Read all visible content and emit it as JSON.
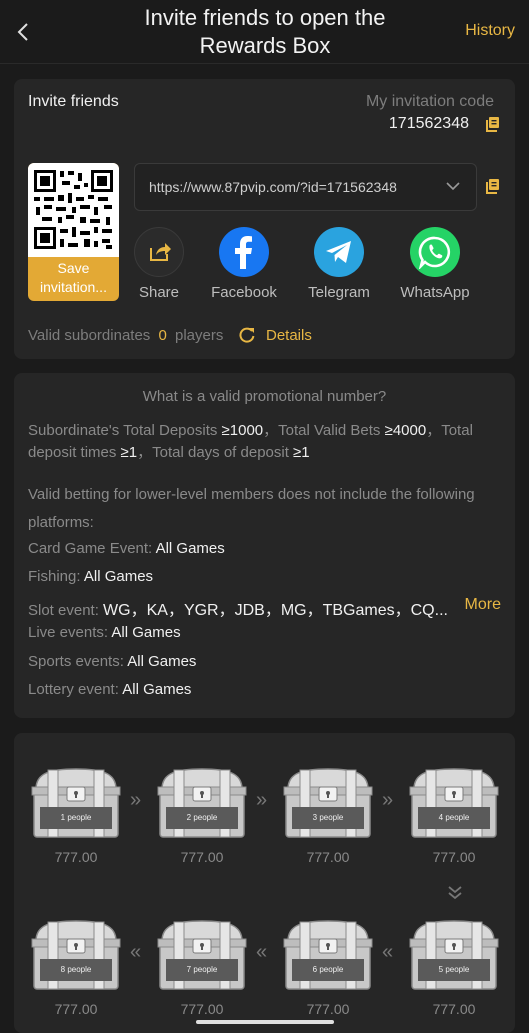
{
  "header": {
    "title": "Invite friends to open the Rewards Box",
    "title_line1": "Invite friends to open the",
    "title_line2": "Rewards Box",
    "history_label": "History",
    "back_icon": "chevron-left-icon"
  },
  "invite": {
    "title": "Invite friends",
    "my_code_label": "My invitation code",
    "my_code": "171562348",
    "url": "https://www.87pvip.com/?id=171562348",
    "save_label_line1": "Save",
    "save_label_line2": "invitation...",
    "share_options": [
      {
        "label": "Share",
        "icon": "share-icon",
        "color": "#2b2b2b"
      },
      {
        "label": "Facebook",
        "icon": "facebook-icon",
        "color": "#1877f2"
      },
      {
        "label": "Telegram",
        "icon": "telegram-icon",
        "color": "#2aa3df"
      },
      {
        "label": "WhatsApp",
        "icon": "whatsapp-icon",
        "color": "#25d366"
      }
    ],
    "valid_label": "Valid subordinates",
    "valid_count": "0",
    "valid_unit": "players",
    "details_label": "Details"
  },
  "rules": {
    "title": "What is a valid promotional number?",
    "requirement_prefix_1": "Subordinate's Total Deposits ",
    "requirement_val_1": "≥1000",
    "requirement_prefix_2": "，Total Valid Bets ",
    "requirement_val_2": "≥4000",
    "requirement_prefix_3": "，Total deposit times ",
    "requirement_val_3": "≥1",
    "requirement_prefix_4": "，Total days of deposit ",
    "requirement_val_4": "≥1",
    "exclusion_note": "Valid betting for lower-level members does not include the following platforms:",
    "platforms": [
      {
        "label": "Card Game Event: ",
        "value": "All Games"
      },
      {
        "label": "Fishing: ",
        "value": "All Games"
      },
      {
        "label": "Slot event: ",
        "value": "WG，KA，YGR，JDB，MG，TBGames，CQ..."
      },
      {
        "label": "Live events: ",
        "value": "All Games"
      },
      {
        "label": "Sports events: ",
        "value": "All Games"
      },
      {
        "label": "Lottery event: ",
        "value": "All Games"
      }
    ],
    "more_label": "More"
  },
  "rewards": {
    "chests": [
      {
        "label": "1 people",
        "amount": "777.00"
      },
      {
        "label": "2 people",
        "amount": "777.00"
      },
      {
        "label": "3 people",
        "amount": "777.00"
      },
      {
        "label": "4 people",
        "amount": "777.00"
      },
      {
        "label": "5 people",
        "amount": "777.00"
      },
      {
        "label": "6 people",
        "amount": "777.00"
      },
      {
        "label": "7 people",
        "amount": "777.00"
      },
      {
        "label": "8 people",
        "amount": "777.00"
      }
    ],
    "arrow_right": "»",
    "arrow_left": "«",
    "arrow_down": "⌄⌄"
  }
}
